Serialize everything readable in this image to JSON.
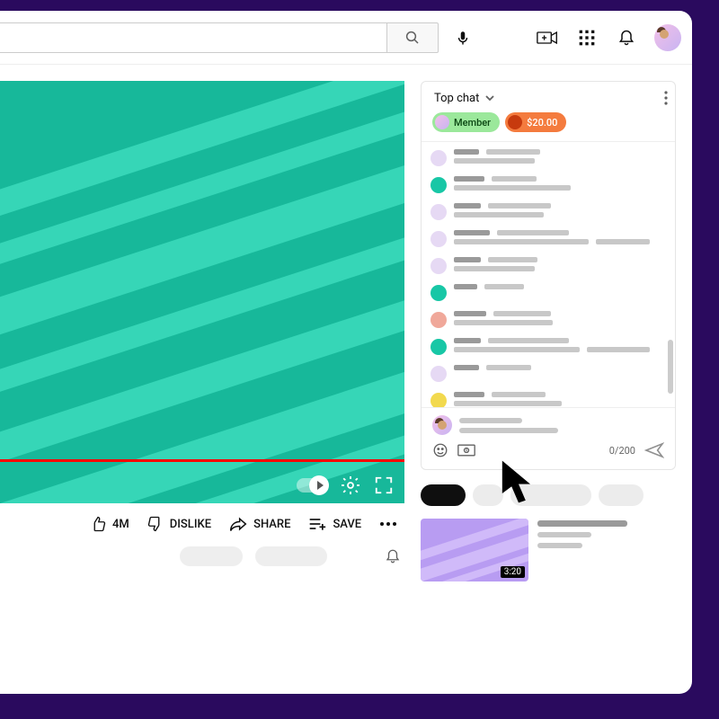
{
  "topbar": {
    "search_placeholder": "",
    "search_aria": "Search"
  },
  "chat": {
    "header_label": "Top chat",
    "badges": {
      "member_label": "Member",
      "money_label": "$20.00"
    },
    "messages": [
      {
        "avatar_color": "#e6d9f4"
      },
      {
        "avatar_color": "#18c7a6"
      },
      {
        "avatar_color": "#e6d9f4"
      },
      {
        "avatar_color": "#e6d9f4"
      },
      {
        "avatar_color": "#e6d9f4"
      },
      {
        "avatar_color": "#18c7a6"
      },
      {
        "avatar_color": "#f0a89a"
      },
      {
        "avatar_color": "#18c7a6"
      },
      {
        "avatar_color": "#e6d9f4"
      },
      {
        "avatar_color": "#f2d94e"
      }
    ],
    "compose": {
      "counter": "0/200"
    }
  },
  "actions": {
    "like_count": "4M",
    "dislike_label": "DISLIKE",
    "share_label": "SHARE",
    "save_label": "SAVE"
  },
  "recommended": {
    "duration": "3:20"
  }
}
